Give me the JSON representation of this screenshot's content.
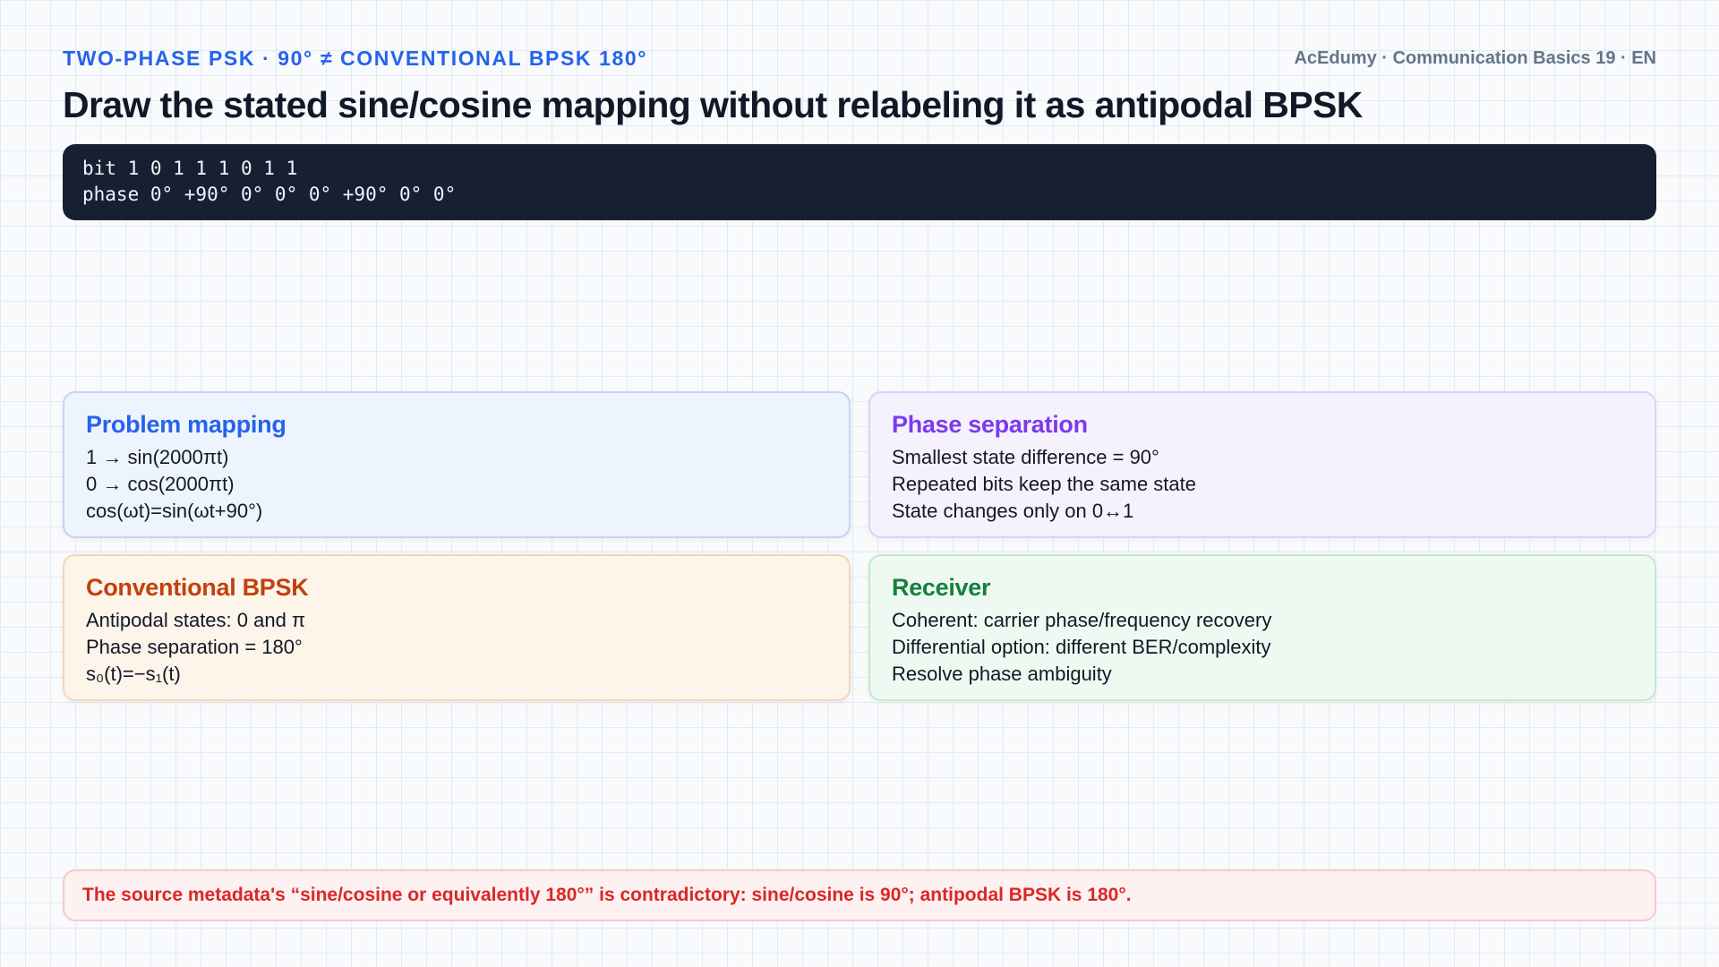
{
  "header": {
    "kicker": "TWO-PHASE PSK · 90° ≠ CONVENTIONAL BPSK 180°",
    "course": "AcEdumy · Communication Basics 19 · EN"
  },
  "title": "Draw the stated sine/cosine mapping without relabeling it as antipodal BPSK",
  "code": {
    "bit_line": "bit 1 0 1 1 1 0 1 1",
    "phase_line": "phase 0° +90° 0° 0° 0° +90° 0° 0°"
  },
  "cards": [
    {
      "title": "Problem mapping",
      "lines": [
        "1 → sin(2000πt)",
        "0 → cos(2000πt)",
        "cos(ωt)=sin(ωt+90°)"
      ],
      "accent": "#2563eb"
    },
    {
      "title": "Phase separation",
      "lines": [
        "Smallest state difference = 90°",
        "Repeated bits keep the same state",
        "State changes only on 0↔1"
      ],
      "accent": "#7c3aed"
    },
    {
      "title": "Conventional BPSK",
      "lines": [
        "Antipodal states: 0 and π",
        "Phase separation = 180°",
        "s₀(t)=−s₁(t)"
      ],
      "accent": "#c2410c"
    },
    {
      "title": "Receiver",
      "lines": [
        "Coherent: carrier phase/frequency recovery",
        "Differential option: different BER/complexity",
        "Resolve phase ambiguity"
      ],
      "accent": "#15803d"
    }
  ],
  "warning": "The source metadata's “sine/cosine or equivalently 180°” is contradictory: sine/cosine is 90°; antipodal BPSK is 180°.",
  "colors": {
    "accent_blue": "#2563eb",
    "code_background": "#172033",
    "warning_red": "#dc2626"
  }
}
